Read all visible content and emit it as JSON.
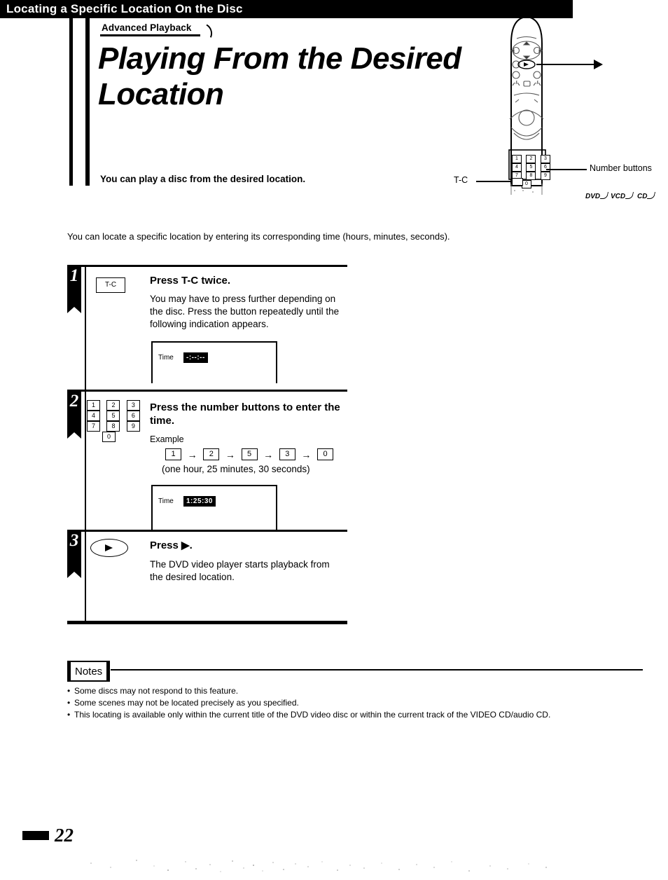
{
  "eyebrow": {
    "label": "Advanced Playback"
  },
  "title": "Playing From the Desired Location",
  "lead": "You can play a disc from the desired location.",
  "section": {
    "heading": "Locating a Specific Location On the Disc"
  },
  "intro": "You can locate a specific location by entering its corresponding time (hours, minutes, seconds).",
  "steps": [
    {
      "number": "1",
      "key_label": "T-C",
      "heading": "Press T-C twice.",
      "body": "You may have to press further depending on the disc. Press the button repeatedly until the following indication appears.",
      "display": {
        "label": "Time",
        "value": "-:--:--"
      }
    },
    {
      "number": "2",
      "heading": "Press the number buttons to enter the time.",
      "example_label": "Example",
      "example_keys": [
        "1",
        "2",
        "5",
        "3",
        "0"
      ],
      "example_arrow": "→",
      "example_note": "(one hour, 25 minutes, 30 seconds)",
      "keypad_rows": [
        [
          "1",
          "2",
          "3"
        ],
        [
          "4",
          "5",
          "6"
        ],
        [
          "7",
          "8",
          "9"
        ],
        [
          "0"
        ]
      ],
      "display": {
        "label": "Time",
        "value": "1:25:30"
      }
    },
    {
      "number": "3",
      "key_glyph": "play-button",
      "heading": "Press ▶.",
      "body": "The DVD video player starts playback from the desired location."
    }
  ],
  "notes": {
    "label": "Notes",
    "items": [
      "Some discs may not respond to this feature.",
      "Some scenes may not be located precisely as you specified.",
      "This locating is available only within the current title of the DVD video disc or within the current track of the VIDEO CD/audio CD."
    ]
  },
  "remote": {
    "callouts": {
      "number_buttons": "Number buttons",
      "tc": "T-C"
    },
    "keypad_rows": [
      [
        "1",
        "2",
        "3"
      ],
      [
        "4",
        "5",
        "6"
      ],
      [
        "7",
        "8",
        "9"
      ],
      [
        "0"
      ]
    ]
  },
  "disc_badges": [
    "DVD",
    "VCD",
    "CD"
  ],
  "footer": {
    "page_number": "22"
  }
}
